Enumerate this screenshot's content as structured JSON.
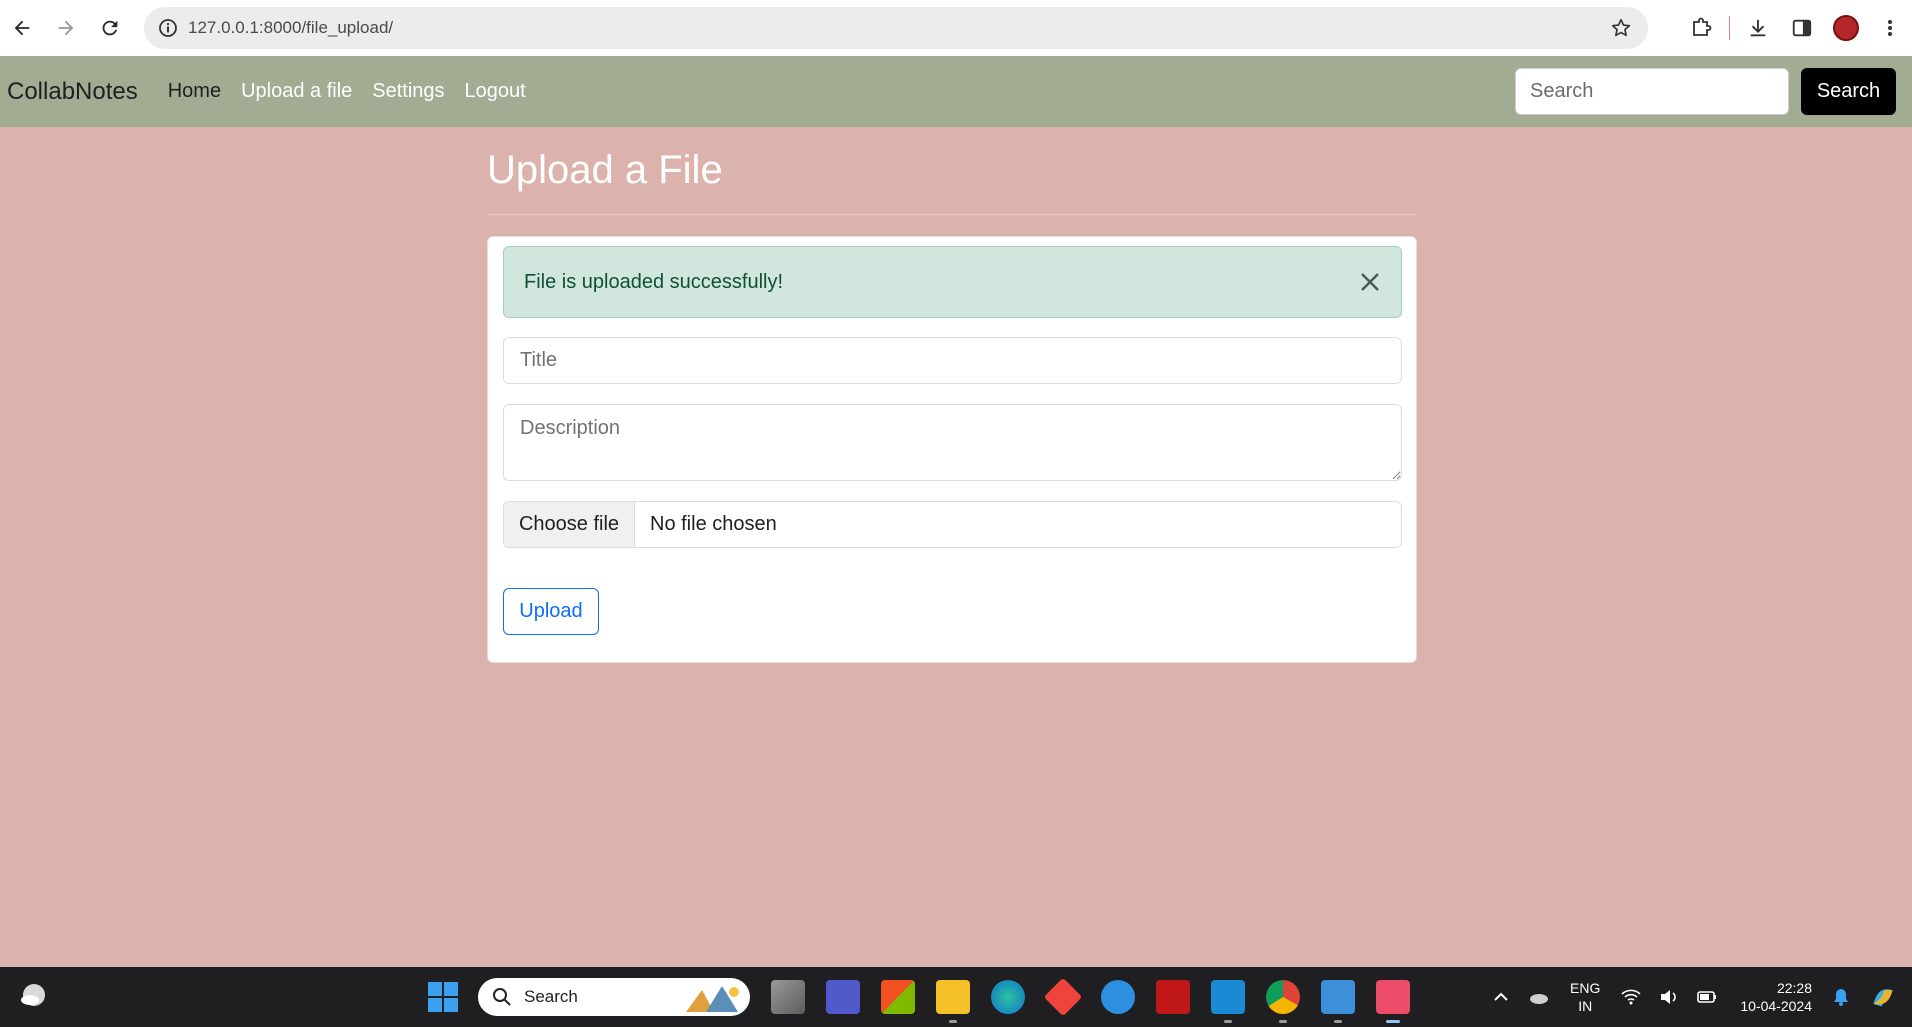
{
  "browser": {
    "url": "127.0.0.1:8000/file_upload/"
  },
  "navbar": {
    "brand": "CollabNotes",
    "links": [
      "Home",
      "Upload a file",
      "Settings",
      "Logout"
    ],
    "search_placeholder": "Search",
    "search_button": "Search"
  },
  "main": {
    "title": "Upload a File",
    "alert": "File is uploaded successfully!",
    "title_placeholder": "Title",
    "description_placeholder": "Description",
    "choose_file_label": "Choose file",
    "no_file_label": "No file chosen",
    "upload_button": "Upload"
  },
  "taskbar": {
    "search_label": "Search",
    "language": "ENG",
    "region": "IN",
    "time": "22:28",
    "date": "10-04-2024"
  },
  "colors": {
    "page_bg": "#dbb3ac",
    "navbar_bg": "#a1ac92",
    "alert_bg": "#d1e7dd",
    "alert_text": "#0f5132",
    "primary": "#0d6efd"
  }
}
